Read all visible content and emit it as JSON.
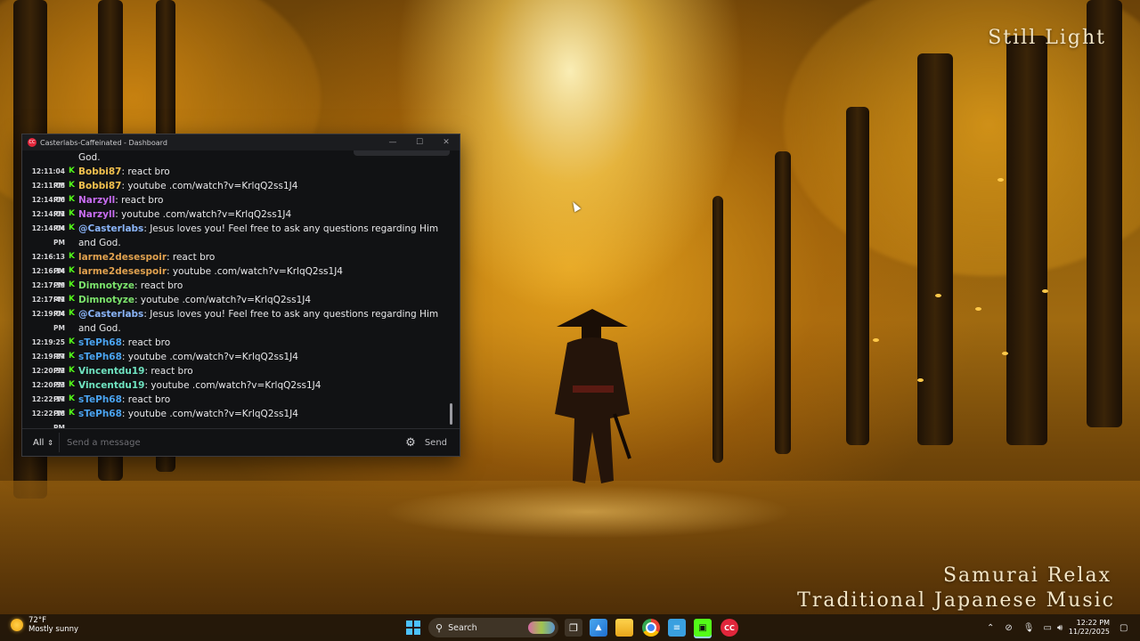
{
  "overlay": {
    "top_right": "Still Light",
    "bottom_line1": "Samurai Relax",
    "bottom_line2": "Traditional Japanese Music"
  },
  "window": {
    "title": "Casterlabs-Caffeinated - Dashboard",
    "app_icon_text": "CC",
    "controls": {
      "minimize": "—",
      "maximize": "☐",
      "close": "✕"
    }
  },
  "chat": {
    "messages": [
      {
        "time": "",
        "user": "",
        "user_color": "",
        "text": "God."
      },
      {
        "time": "12:11:04 PM",
        "user": "Bobbi87",
        "user_color": "#f2c14e",
        "text": ": react bro"
      },
      {
        "time": "12:11:05 PM",
        "user": "Bobbi87",
        "user_color": "#f2c14e",
        "text": ": youtube .com/watch?v=KrlqQ2ss1J4"
      },
      {
        "time": "12:14:00 PM",
        "user": "Narzyll",
        "user_color": "#c76cf0",
        "text": ": react bro"
      },
      {
        "time": "12:14:01 PM",
        "user": "Narzyll",
        "user_color": "#c76cf0",
        "text": ": youtube .com/watch?v=KrlqQ2ss1J4"
      },
      {
        "time": "12:14:04 PM",
        "user": "@Casterlabs",
        "user_color": "#8ab4f8",
        "text": ": Jesus loves you! Feel free to ask any questions regarding Him and God."
      },
      {
        "time": "12:16:13 PM",
        "user": "larme2desespoir",
        "user_color": "#e0a14f",
        "text": ": react bro"
      },
      {
        "time": "12:16:14 PM",
        "user": "larme2desespoir",
        "user_color": "#e0a14f",
        "text": ": youtube .com/watch?v=KrlqQ2ss1J4"
      },
      {
        "time": "12:17:39 PM",
        "user": "Dimnotyze",
        "user_color": "#7be36b",
        "text": ": react bro"
      },
      {
        "time": "12:17:41 PM",
        "user": "Dimnotyze",
        "user_color": "#7be36b",
        "text": ": youtube .com/watch?v=KrlqQ2ss1J4"
      },
      {
        "time": "12:19:04 PM",
        "user": "@Casterlabs",
        "user_color": "#8ab4f8",
        "text": ": Jesus loves you! Feel free to ask any questions regarding Him and God."
      },
      {
        "time": "12:19:25 PM",
        "user": "sTePh68",
        "user_color": "#4aa3f0",
        "text": ": react bro"
      },
      {
        "time": "12:19:27 PM",
        "user": "sTePh68",
        "user_color": "#4aa3f0",
        "text": ": youtube .com/watch?v=KrlqQ2ss1J4"
      },
      {
        "time": "12:20:52 PM",
        "user": "Vincentdu19",
        "user_color": "#6fe3c0",
        "text": ": react bro"
      },
      {
        "time": "12:20:53 PM",
        "user": "Vincentdu19",
        "user_color": "#6fe3c0",
        "text": ": youtube .com/watch?v=KrlqQ2ss1J4"
      },
      {
        "time": "12:22:17 PM",
        "user": "sTePh68",
        "user_color": "#4aa3f0",
        "text": ": react bro"
      },
      {
        "time": "12:22:18 PM",
        "user": "sTePh68",
        "user_color": "#4aa3f0",
        "text": ": youtube .com/watch?v=KrlqQ2ss1J4"
      }
    ],
    "platform_icon": "kick-icon",
    "filter_value": "All",
    "input_placeholder": "Send a message",
    "send_label": "Send"
  },
  "taskbar": {
    "weather_temp": "72°F",
    "weather_desc": "Mostly sunny",
    "search_label": "Search",
    "time": "12:22 PM",
    "date": "11/22/2025"
  }
}
